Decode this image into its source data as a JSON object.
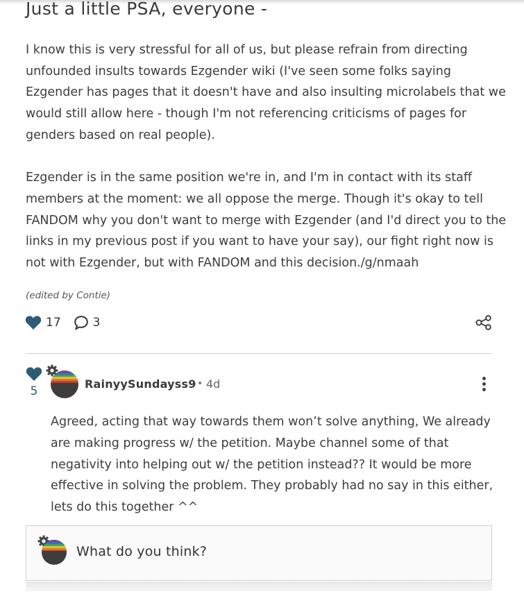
{
  "post": {
    "title": "Just a little PSA, everyone -",
    "paragraph1": [
      "I know this is very stressful for all of us, but please refrain from directing",
      "unfounded insults towards Ezgender wiki (I've seen some folks saying",
      "Ezgender has pages that it doesn't have and also insulting microlabels that we",
      "would still allow here - though I'm not referencing criticisms of pages for",
      "genders based on real people)."
    ],
    "paragraph2": [
      "Ezgender is in the same position we're in, and I'm in contact with its staff",
      "members at the moment: we all oppose the merge. Though it's okay to tell",
      "FANDOM why you don't want to merge with Ezgender (and I'd direct you to the",
      "links in my previous post if you want to have your say), our fight right now is",
      "not with Ezgender, but with FANDOM and this decision./g/nmaah"
    ],
    "edited_note": "(edited by Contie)",
    "likes": "17",
    "comments": "3"
  },
  "reply": {
    "likes": "5",
    "author": "RainyySundayss9",
    "separator": "•",
    "time": "4d",
    "lines": [
      "Agreed, acting that way towards them won’t solve anything, We already",
      "are making progress w/ the petition. Maybe channel some of that",
      "negativity into helping out w/ the petition instead?? It would be more",
      "effective in solving the problem. They probably had no say in this either,",
      "lets do this together ^^"
    ]
  },
  "composer": {
    "placeholder": "What do you think?"
  },
  "colors": {
    "heart": "#2c5d74",
    "text": "#3d3d3d"
  }
}
